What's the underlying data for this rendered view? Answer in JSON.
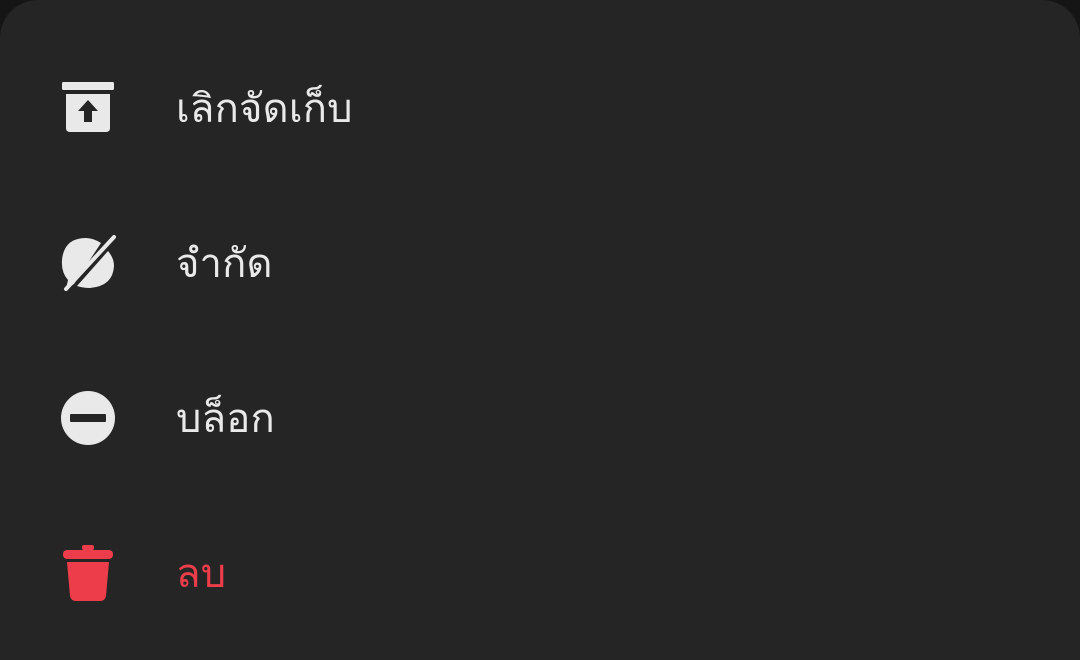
{
  "menu": {
    "items": [
      {
        "label": "เลิกจัดเก็บ",
        "icon": "unarchive-icon"
      },
      {
        "label": "จำกัด",
        "icon": "restrict-icon"
      },
      {
        "label": "บล็อก",
        "icon": "block-icon"
      },
      {
        "label": "ลบ",
        "icon": "trash-icon"
      }
    ]
  },
  "colors": {
    "background": "#252525",
    "text": "#e9e9ea",
    "danger": "#ee3d4a"
  }
}
